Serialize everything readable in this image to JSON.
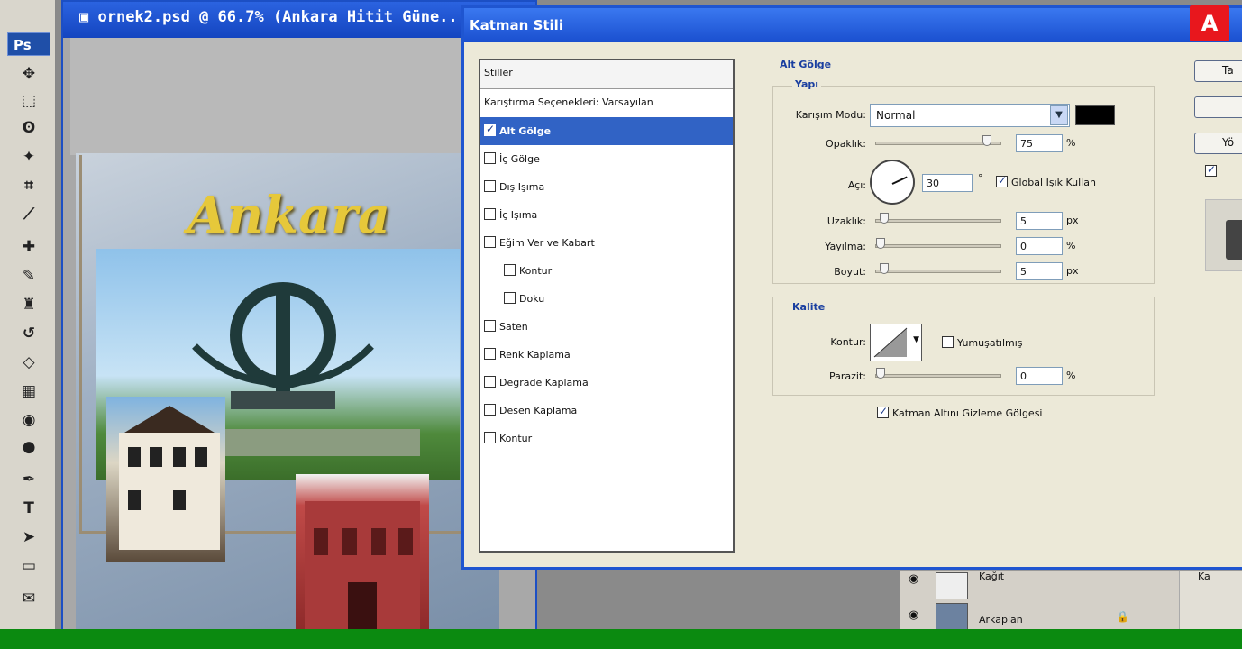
{
  "document": {
    "title": "ornek2.psd @ 66.7% (Ankara Hitit Güne..."
  },
  "toolbox": {
    "ps_label": "Ps",
    "type_tool": "T"
  },
  "artwork": {
    "ankara_text": "Ankara"
  },
  "dialog": {
    "title": "Katman Stili",
    "logo_text": "A",
    "styles_list": {
      "header": "Stiller",
      "blend_options": "Karıştırma Seçenekleri: Varsayılan",
      "items": [
        {
          "label": "Alt Gölge",
          "checked": true,
          "selected": true,
          "sub": false
        },
        {
          "label": "İç Gölge",
          "checked": false,
          "selected": false,
          "sub": false
        },
        {
          "label": "Dış Işıma",
          "checked": false,
          "selected": false,
          "sub": false
        },
        {
          "label": "İç Işıma",
          "checked": false,
          "selected": false,
          "sub": false
        },
        {
          "label": "Eğim Ver ve Kabart",
          "checked": false,
          "selected": false,
          "sub": false
        },
        {
          "label": "Kontur",
          "checked": false,
          "selected": false,
          "sub": true
        },
        {
          "label": "Doku",
          "checked": false,
          "selected": false,
          "sub": true
        },
        {
          "label": "Saten",
          "checked": false,
          "selected": false,
          "sub": false
        },
        {
          "label": "Renk Kaplama",
          "checked": false,
          "selected": false,
          "sub": false
        },
        {
          "label": "Degrade Kaplama",
          "checked": false,
          "selected": false,
          "sub": false
        },
        {
          "label": "Desen Kaplama",
          "checked": false,
          "selected": false,
          "sub": false
        },
        {
          "label": "Kontur",
          "checked": false,
          "selected": false,
          "sub": false
        }
      ]
    },
    "drop_shadow": {
      "section_title": "Alt Gölge",
      "structure_title": "Yapı",
      "blend_mode_label": "Karışım Modu:",
      "blend_mode_value": "Normal",
      "shadow_color": "#000000",
      "opacity_label": "Opaklık:",
      "opacity_value": "75",
      "opacity_unit": "%",
      "angle_label": "Açı:",
      "angle_value": "30",
      "angle_unit": "°",
      "global_light_label": "Global Işık Kullan",
      "global_light_checked": true,
      "distance_label": "Uzaklık:",
      "distance_value": "5",
      "distance_unit": "px",
      "spread_label": "Yayılma:",
      "spread_value": "0",
      "spread_unit": "%",
      "size_label": "Boyut:",
      "size_value": "5",
      "size_unit": "px"
    },
    "quality": {
      "section_title": "Kalite",
      "contour_label": "Kontur:",
      "antialias_label": "Yumuşatılmış",
      "antialias_checked": false,
      "noise_label": "Parazit:",
      "noise_value": "0",
      "noise_unit": "%"
    },
    "knockout_label": "Katman Altını Gizleme Gölgesi",
    "knockout_checked": true,
    "buttons": {
      "ok": "Ta",
      "new_style": "Yö"
    }
  },
  "layers": {
    "rows": [
      {
        "name": "Kağıt"
      },
      {
        "name": "Arkaplan"
      }
    ],
    "side_label": "Ka"
  },
  "colors": {
    "titlebar_blue": "#1f55d0",
    "selection_blue": "#3163c5",
    "dialog_bg": "#ece9d8",
    "taskbar_green": "#0b8a10",
    "adobe_red": "#e8171d",
    "ankara_gold": "#e6c83a"
  }
}
